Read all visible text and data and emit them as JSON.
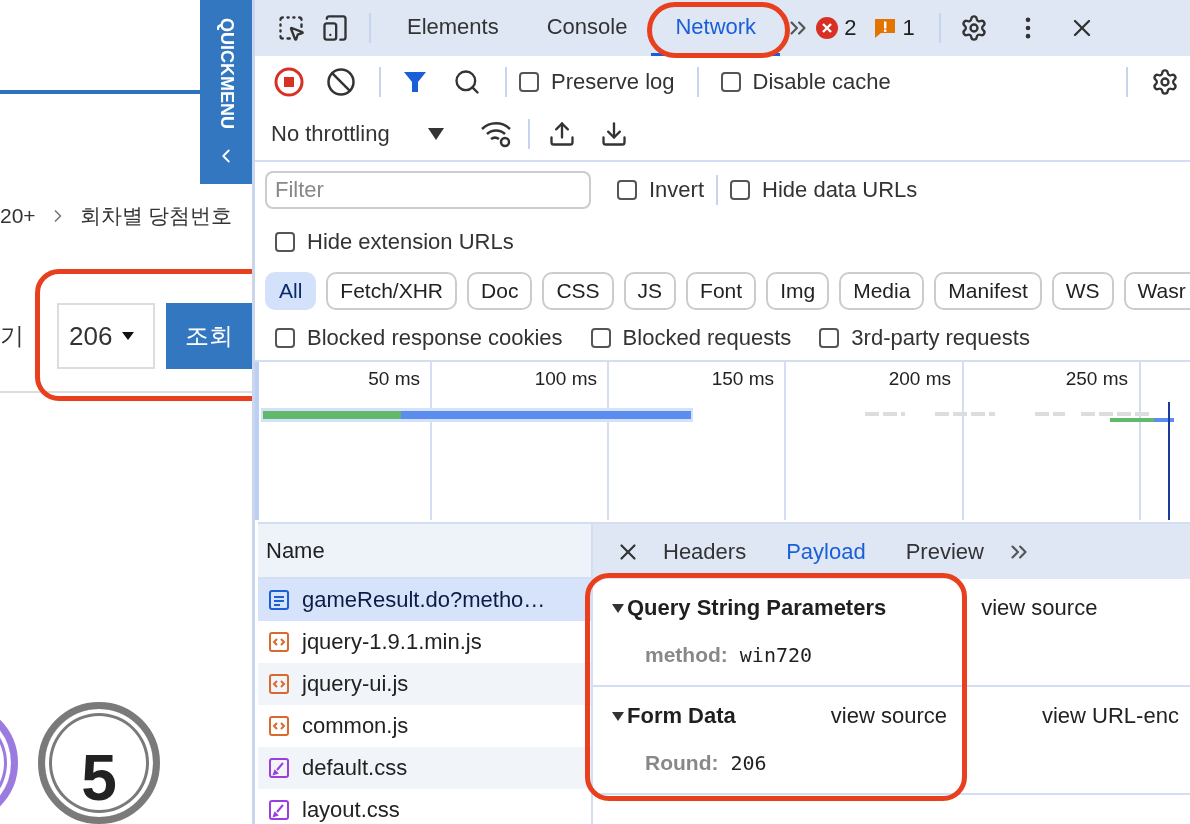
{
  "page": {
    "quickmenu": "QUICKMENU",
    "breadcrumb": [
      "20+",
      "회차별 당첨번호"
    ],
    "round_label": "기",
    "round_select": {
      "value": "206",
      "highlighted": true
    },
    "search_button": "조회",
    "balls": [
      {
        "color": "#9b7be0"
      },
      {
        "number": "5",
        "color": "#7a7a7a"
      }
    ]
  },
  "devtools": {
    "tabs": [
      {
        "label": "Elements",
        "selected": false,
        "highlighted": false
      },
      {
        "label": "Console",
        "selected": false,
        "highlighted": false
      },
      {
        "label": "Network",
        "selected": true,
        "highlighted": true
      }
    ],
    "errors": "2",
    "warnings": "1",
    "preserve_log": {
      "label": "Preserve log",
      "checked": false
    },
    "disable_cache": {
      "label": "Disable cache",
      "checked": false
    },
    "throttling": "No throttling",
    "filter": {
      "placeholder": "Filter"
    },
    "invert": {
      "label": "Invert",
      "checked": false
    },
    "hide_data_urls": {
      "label": "Hide data URLs",
      "checked": false
    },
    "hide_extension_urls": {
      "label": "Hide extension URLs",
      "checked": false
    },
    "type_filters": [
      {
        "label": "All",
        "selected": true
      },
      {
        "label": "Fetch/XHR",
        "selected": false
      },
      {
        "label": "Doc",
        "selected": false
      },
      {
        "label": "CSS",
        "selected": false
      },
      {
        "label": "JS",
        "selected": false
      },
      {
        "label": "Font",
        "selected": false
      },
      {
        "label": "Img",
        "selected": false
      },
      {
        "label": "Media",
        "selected": false
      },
      {
        "label": "Manifest",
        "selected": false
      },
      {
        "label": "WS",
        "selected": false
      },
      {
        "label": "Wasr",
        "selected": false
      }
    ],
    "more_filters": [
      {
        "label": "Blocked response cookies",
        "checked": false
      },
      {
        "label": "Blocked requests",
        "checked": false
      },
      {
        "label": "3rd-party requests",
        "checked": false
      }
    ],
    "timeline_ticks": [
      "50 ms",
      "100 ms",
      "150 ms",
      "200 ms",
      "250 ms"
    ],
    "name_column": "Name",
    "requests": [
      {
        "name": "gameResult.do?metho…",
        "kind": "document",
        "selected": true
      },
      {
        "name": "jquery-1.9.1.min.js",
        "kind": "script",
        "selected": false
      },
      {
        "name": "jquery-ui.js",
        "kind": "script",
        "selected": false
      },
      {
        "name": "common.js",
        "kind": "script",
        "selected": false
      },
      {
        "name": "default.css",
        "kind": "stylesheet",
        "selected": false
      },
      {
        "name": "layout.css",
        "kind": "stylesheet",
        "selected": false
      }
    ],
    "detail_tabs": [
      {
        "label": "Headers",
        "selected": false
      },
      {
        "label": "Payload",
        "selected": true
      },
      {
        "label": "Preview",
        "selected": false
      }
    ],
    "payload": {
      "highlighted": true,
      "sections": [
        {
          "title": "Query String Parameters",
          "expanded": true,
          "links": [
            "view source"
          ],
          "params": [
            {
              "key": "method:",
              "value": "win720"
            }
          ]
        },
        {
          "title": "Form Data",
          "expanded": true,
          "links": [
            "view source",
            "view URL-enc"
          ],
          "params": [
            {
              "key": "Round:",
              "value": "206"
            }
          ]
        }
      ]
    }
  }
}
